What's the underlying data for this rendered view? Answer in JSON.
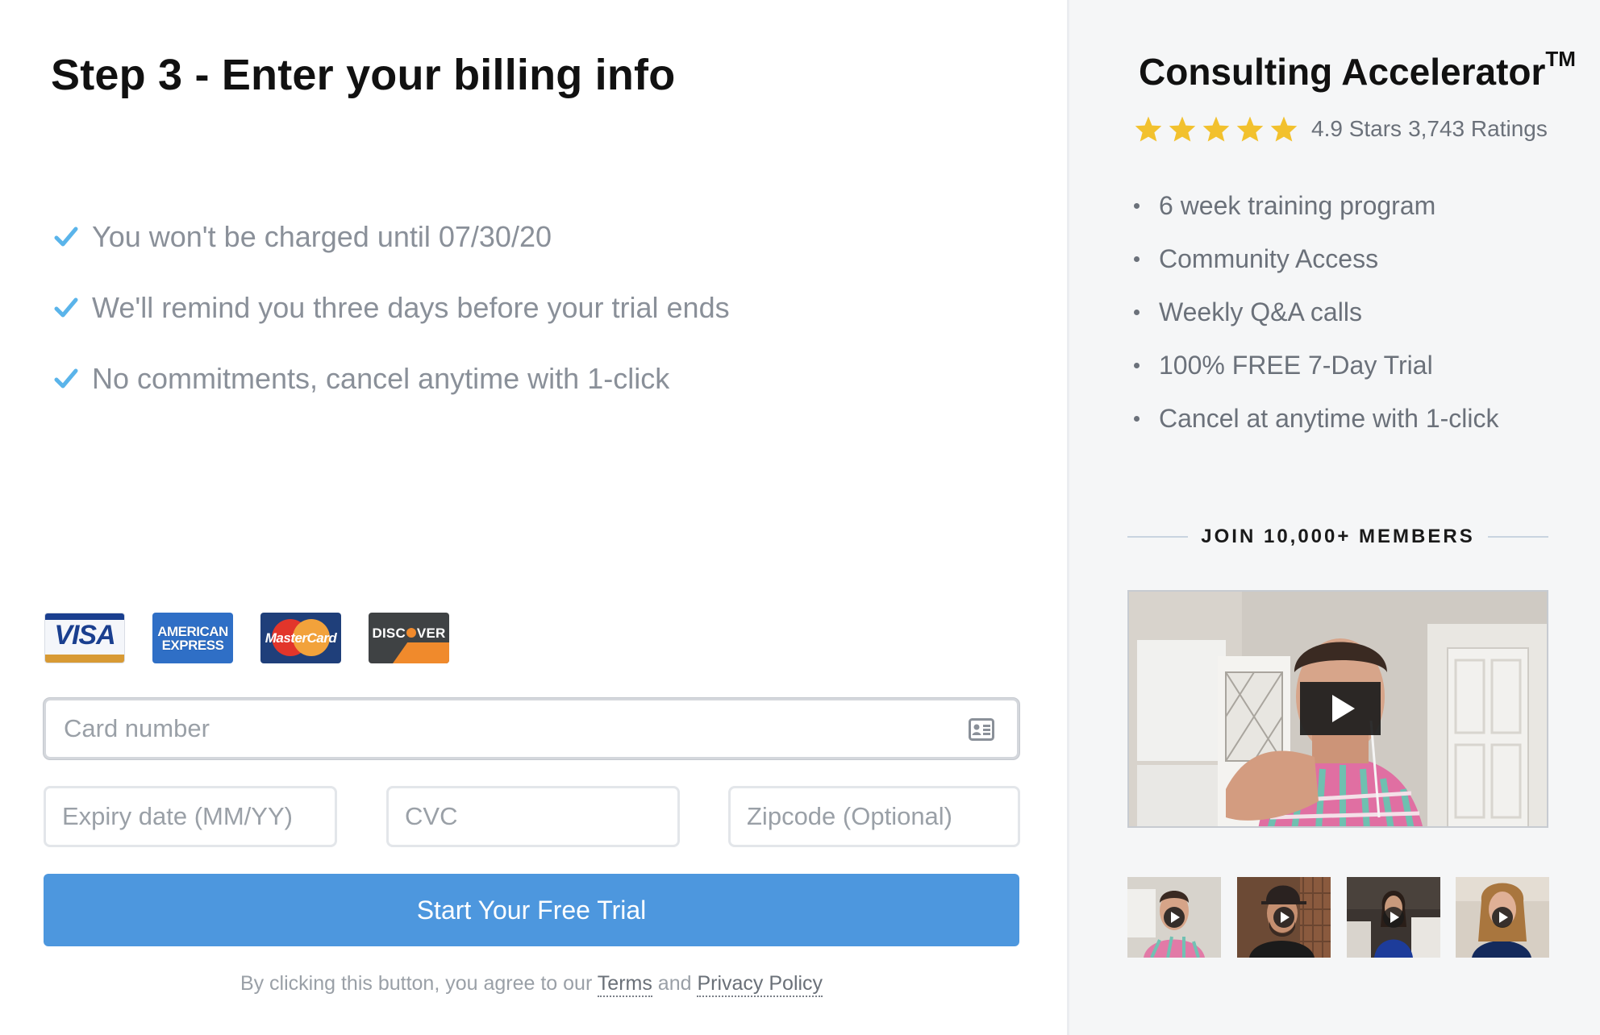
{
  "billing": {
    "title": "Step 3 - Enter your billing info",
    "checks": [
      "You won't be charged until 07/30/20",
      "We'll remind you three days before your trial ends",
      "No commitments, cancel anytime with 1-click"
    ],
    "cards": {
      "visa": "VISA",
      "amex_line1": "AMERICAN",
      "amex_line2": "EXPRESS",
      "mastercard": "MasterCard",
      "discover_pre": "DISC",
      "discover_post": "VER"
    },
    "fields": {
      "card_number_placeholder": "Card number",
      "expiry_placeholder": "Expiry date (MM/YY)",
      "cvc_placeholder": "CVC",
      "zip_placeholder": "Zipcode (Optional)"
    },
    "cta_label": "Start Your Free Trial",
    "legal": {
      "prefix": "By clicking this button, you agree to our ",
      "terms": "Terms",
      "and": " and ",
      "privacy": "Privacy Policy"
    }
  },
  "product": {
    "title": "Consulting Accelerator",
    "tm": "TM",
    "rating_stars": 5,
    "rating_value": "4.9 Stars",
    "rating_count": "3,743 Ratings",
    "features": [
      "6 week training program",
      "Community Access",
      "Weekly Q&A calls",
      "100% FREE 7-Day Trial",
      "Cancel at anytime with 1-click"
    ],
    "join_label": "JOIN 10,000+ MEMBERS"
  },
  "colors": {
    "accent": "#4d97de",
    "check": "#5ab4ea",
    "star": "#f2c12e",
    "text_muted": "#8a9099"
  },
  "icons": {
    "check": "check-icon",
    "star": "star-icon",
    "card_id": "id-card-icon",
    "play": "play-icon"
  }
}
